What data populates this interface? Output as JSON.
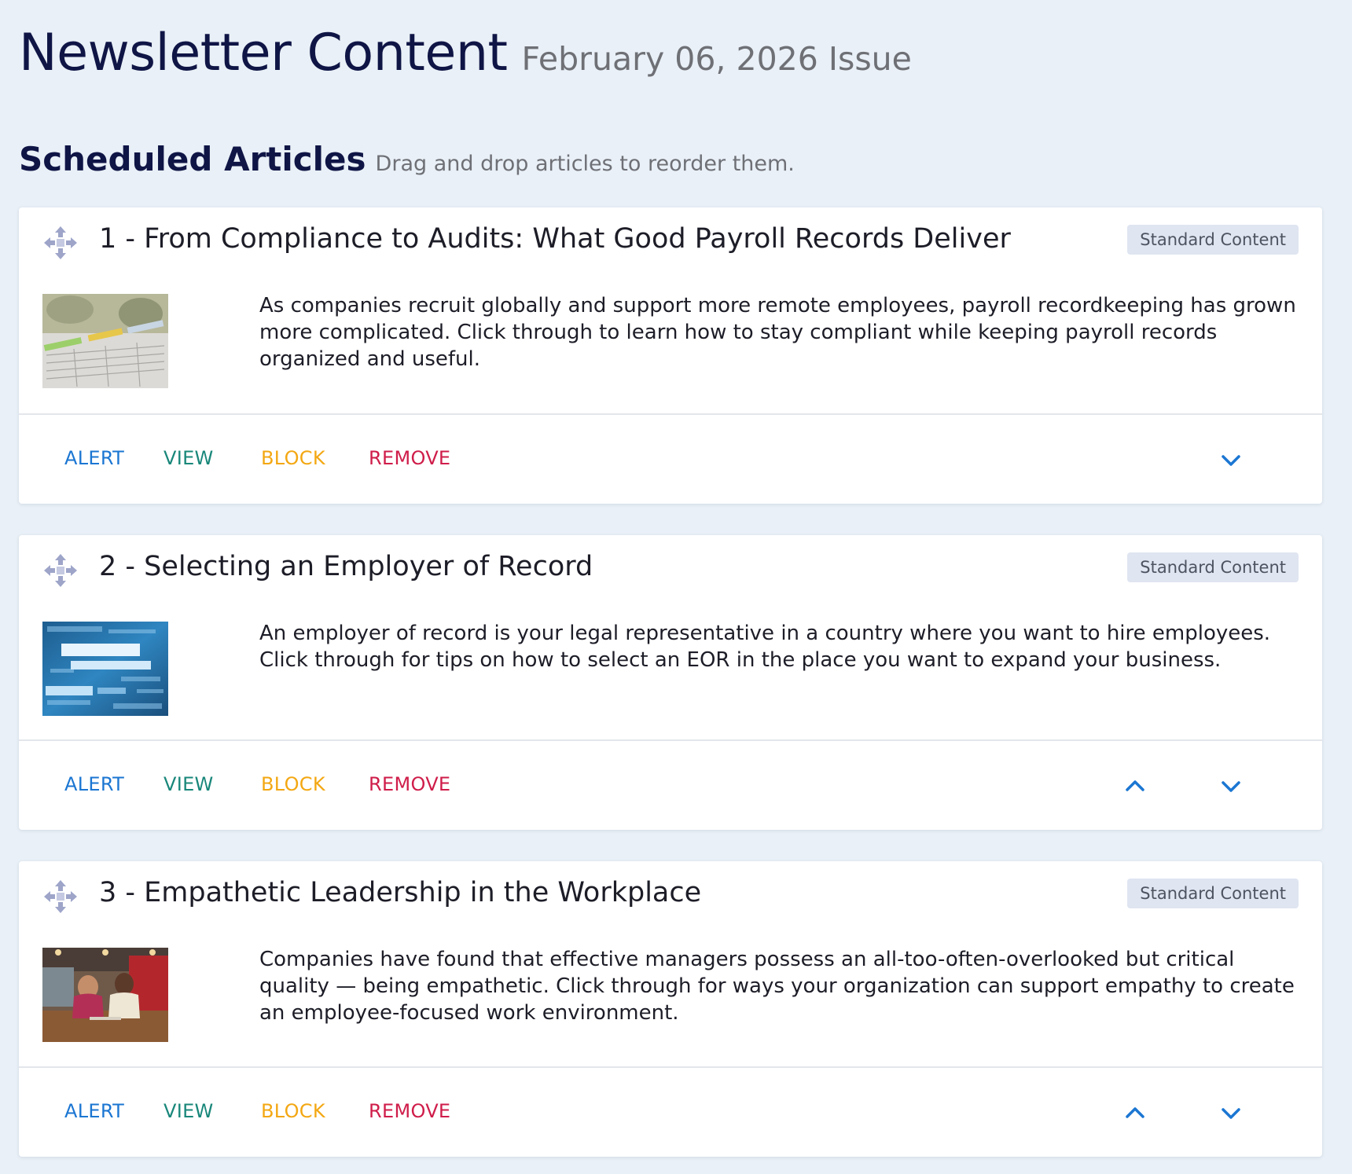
{
  "header": {
    "title": "Newsletter Content",
    "issue": "February 06, 2026 Issue"
  },
  "section": {
    "title": "Scheduled Articles",
    "hint": "Drag and drop articles to reorder them."
  },
  "actions": {
    "alert": "ALERT",
    "view": "VIEW",
    "block": "BLOCK",
    "remove": "REMOVE"
  },
  "articles": [
    {
      "title": "1 - From Compliance to Audits: What Good Payroll Records Deliver",
      "badge": "Standard Content",
      "description": "As companies recruit globally and support more remote employees, payroll recordkeeping has grown more complicated. Click through to learn how to stay compliant while keeping payroll records organized and useful.",
      "thumbnail": "payroll-records-image"
    },
    {
      "title": "2 - Selecting an Employer of Record",
      "badge": "Standard Content",
      "description": "An employer of record is your legal representative in a country where you want to hire employees. Click through for tips on how to select an EOR in the place you want to expand your business.",
      "thumbnail": "records-management-image"
    },
    {
      "title": "3 - Empathetic Leadership in the Workplace",
      "badge": "Standard Content",
      "description": "Companies have found that effective managers possess an all-too-often-overlooked but critical quality — being empathetic. Click through for ways your organization can support empathy to create an employee-focused work environment.",
      "thumbnail": "office-meeting-image"
    }
  ],
  "icons": {
    "drag": "move-arrows-icon",
    "up": "chevron-up-icon",
    "down": "chevron-down-icon"
  },
  "colors": {
    "background": "#e9f0f7",
    "alert": "#1b76d2",
    "view": "#19877a",
    "block": "#f3a712",
    "remove": "#cf1d4a",
    "badge_bg": "#dfe5f1"
  }
}
